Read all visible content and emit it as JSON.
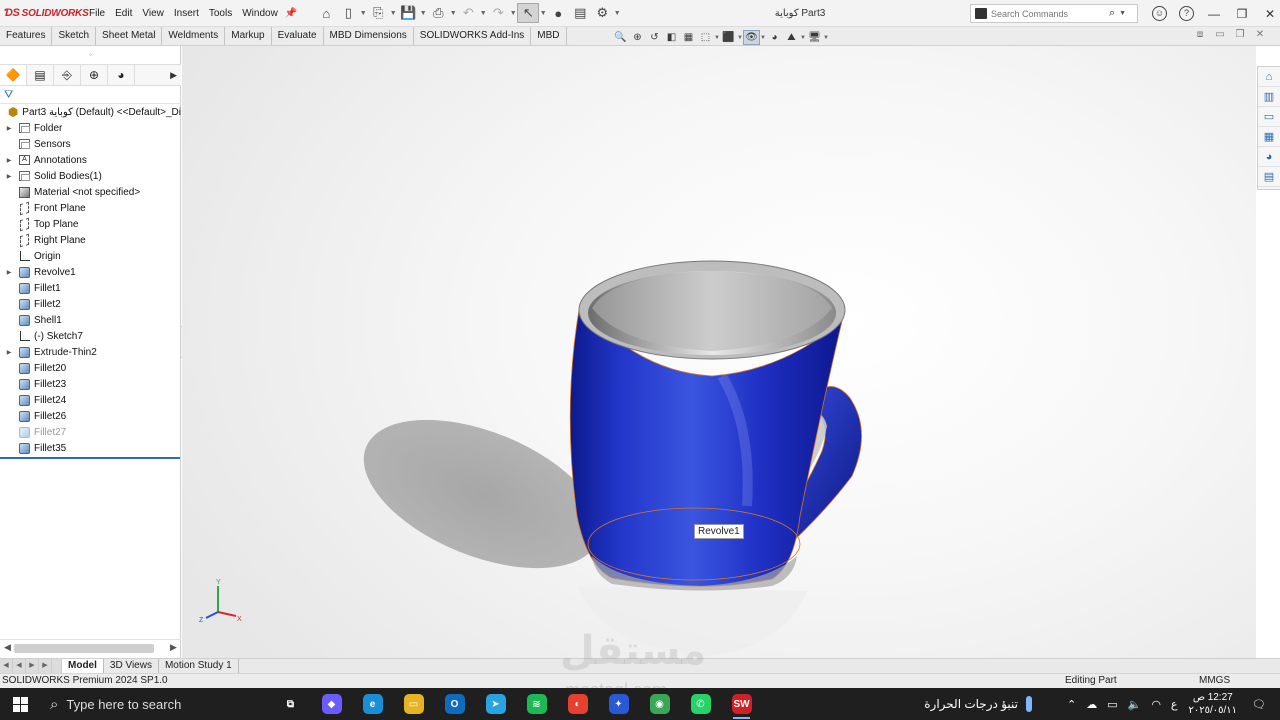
{
  "app": {
    "brand": "SOLIDWORKS",
    "document_title": "كوباية Part3",
    "search_placeholder": "Search Commands"
  },
  "menu": [
    "File",
    "Edit",
    "View",
    "Insert",
    "Tools",
    "Window"
  ],
  "command_tabs": [
    "Features",
    "Sketch",
    "Sheet Metal",
    "Weldments",
    "Markup",
    "Evaluate",
    "MBD Dimensions",
    "SOLIDWORKS Add-Ins",
    "MBD"
  ],
  "feature_tree": {
    "root_label": "Part3 كوباية (Default) <<Default>_Di",
    "items": [
      {
        "label": "Folder",
        "icon": "folder-icon",
        "expandable": true
      },
      {
        "label": "Sensors",
        "icon": "sensors-icon",
        "expandable": false
      },
      {
        "label": "Annotations",
        "icon": "annotations-icon",
        "expandable": true
      },
      {
        "label": "Solid Bodies(1)",
        "icon": "solid-bodies-icon",
        "expandable": true
      },
      {
        "label": "Material <not specified>",
        "icon": "material-icon",
        "expandable": false
      },
      {
        "label": "Front Plane",
        "icon": "plane-icon",
        "expandable": false
      },
      {
        "label": "Top Plane",
        "icon": "plane-icon",
        "expandable": false
      },
      {
        "label": "Right Plane",
        "icon": "plane-icon",
        "expandable": false
      },
      {
        "label": "Origin",
        "icon": "origin-icon",
        "expandable": false
      },
      {
        "label": "Revolve1",
        "icon": "revolve-icon",
        "expandable": true
      },
      {
        "label": "Fillet1",
        "icon": "fillet-icon",
        "expandable": false
      },
      {
        "label": "Fillet2",
        "icon": "fillet-icon",
        "expandable": false
      },
      {
        "label": "Shell1",
        "icon": "shell-icon",
        "expandable": false
      },
      {
        "label": "(-) Sketch7",
        "icon": "sketch-icon",
        "expandable": false
      },
      {
        "label": "Extrude-Thin2",
        "icon": "extrude-icon",
        "expandable": true
      },
      {
        "label": "Fillet20",
        "icon": "fillet-icon",
        "expandable": false
      },
      {
        "label": "Fillet23",
        "icon": "fillet-icon",
        "expandable": false
      },
      {
        "label": "Fillet24",
        "icon": "fillet-icon",
        "expandable": false
      },
      {
        "label": "Fillet26",
        "icon": "fillet-icon",
        "expandable": false
      },
      {
        "label": "Fillet27",
        "icon": "fillet-icon",
        "expandable": false,
        "suppressed": true
      },
      {
        "label": "Fillet35",
        "icon": "fillet-icon",
        "expandable": false
      }
    ]
  },
  "viewport": {
    "tooltip": "Revolve1",
    "model_color": "#1f2fc4",
    "triad_labels": {
      "x": "X",
      "y": "Y",
      "z": "Z"
    }
  },
  "model_tabs": [
    "Model",
    "3D Views",
    "Motion Study 1"
  ],
  "status_bar": {
    "product": "SOLIDWORKS Premium 2024 SP1.0",
    "mode": "Editing Part",
    "units": "MMGS"
  },
  "taskbar": {
    "search_placeholder": "Type here to search",
    "weather": "تنبؤ درجات الحرارة",
    "time": "12:27 ص",
    "date": "٢٠٢٥/٠٥/١١",
    "language": "ع",
    "apps": [
      {
        "name": "task-view",
        "color": "#1f1f1f",
        "glyph": "⧉"
      },
      {
        "name": "copilot",
        "color": "#6a5cff",
        "glyph": "◆"
      },
      {
        "name": "edge",
        "color": "#1b8fd6",
        "glyph": "e"
      },
      {
        "name": "file-explorer",
        "color": "#e6b422",
        "glyph": "▭"
      },
      {
        "name": "outlook",
        "color": "#0f6cbd",
        "glyph": "O"
      },
      {
        "name": "telegram",
        "color": "#2aa3e0",
        "glyph": "➤"
      },
      {
        "name": "spotify",
        "color": "#1db954",
        "glyph": "≋"
      },
      {
        "name": "office",
        "color": "#e8402f",
        "glyph": "◐"
      },
      {
        "name": "vpn",
        "color": "#2b59d6",
        "glyph": "✦"
      },
      {
        "name": "chrome",
        "color": "#3aa757",
        "glyph": "◉"
      },
      {
        "name": "whatsapp",
        "color": "#25d366",
        "glyph": "✆"
      },
      {
        "name": "solidworks",
        "color": "#d02127",
        "glyph": "SW"
      }
    ]
  },
  "watermark": {
    "arabic": "مستقل",
    "latin": "mostaql.com"
  }
}
